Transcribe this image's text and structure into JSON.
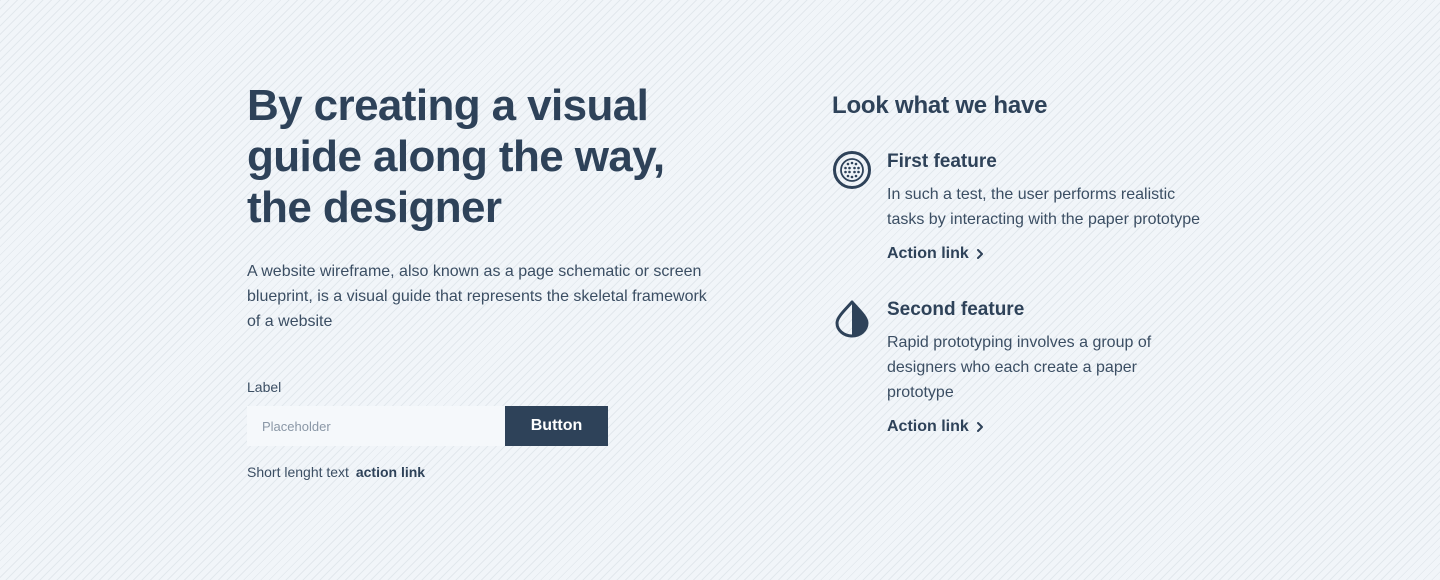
{
  "hero": {
    "title": "By creating a visual guide along the way, the designer",
    "description": "A website wireframe, also known as a page schematic or screen blueprint, is a visual guide that represents the skeletal framework of a website"
  },
  "form": {
    "label": "Label",
    "input_placeholder": "Placeholder",
    "input_value": "",
    "button_label": "Button",
    "short_text": "Short lenght text",
    "short_link": "action link"
  },
  "features": {
    "section_title": "Look what we have",
    "items": [
      {
        "icon": "dotted-globe-icon",
        "title": "First feature",
        "description": "In such a test, the user performs realistic tasks by interacting with the paper prototype",
        "link": "Action link"
      },
      {
        "icon": "half-drop-icon",
        "title": "Second feature",
        "description": "Rapid prototyping involves a group of designers who each create a paper prototype",
        "link": "Action link"
      }
    ]
  },
  "colors": {
    "primary": "#2e4259",
    "text": "#3b4e63",
    "background": "#f1f5f9",
    "input_background": "#f5f8fb",
    "button_text": "#ffffff"
  }
}
